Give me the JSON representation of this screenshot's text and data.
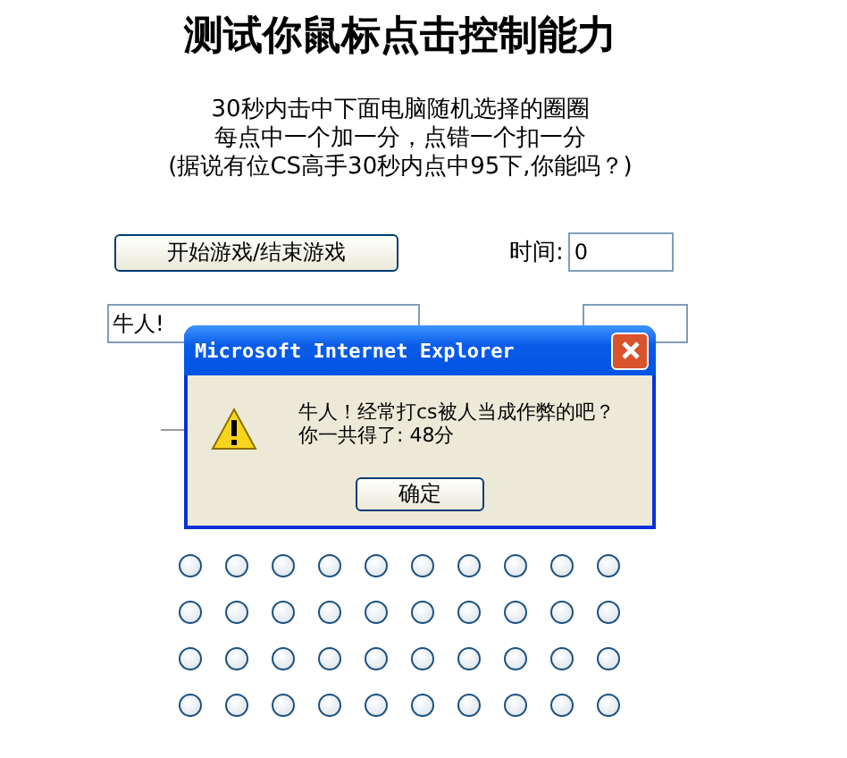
{
  "heading": "测试你鼠标点击控制能力",
  "intro": [
    "30秒内击中下面电脑随机选择的圈圈",
    "每点中一个加一分，点错一个扣一分",
    "(据说有位CS高手30秒内点中95下,你能吗？)"
  ],
  "start_button": "开始游戏/结束游戏",
  "time": {
    "label": "时间:",
    "value": "0"
  },
  "message_field": {
    "value": "牛人!"
  },
  "grid": [
    {
      "circles": [
        {
          "selected": false
        },
        {
          "selected": false
        },
        {
          "selected": false
        },
        {
          "selected": false
        },
        {
          "selected": false
        },
        {
          "selected": false
        },
        {
          "selected": false
        },
        {
          "selected": false
        },
        {
          "selected": false
        },
        {
          "selected": false
        }
      ]
    },
    {
      "circles": [
        {
          "selected": false
        },
        {
          "selected": false
        },
        {
          "selected": false
        },
        {
          "selected": false
        },
        {
          "selected": false
        },
        {
          "selected": false
        },
        {
          "selected": false
        },
        {
          "selected": false
        },
        {
          "selected": false
        },
        {
          "selected": false
        }
      ]
    },
    {
      "circles": [
        {
          "selected": false
        },
        {
          "selected": false
        },
        {
          "selected": false
        },
        {
          "selected": false
        },
        {
          "selected": false
        },
        {
          "selected": false
        },
        {
          "selected": false
        },
        {
          "selected": false
        },
        {
          "selected": false
        },
        {
          "selected": false
        }
      ]
    },
    {
      "circles": [
        {
          "selected": false
        },
        {
          "selected": false
        },
        {
          "selected": false
        },
        {
          "selected": false
        },
        {
          "selected": false
        },
        {
          "selected": false
        },
        {
          "selected": false
        },
        {
          "selected": false
        },
        {
          "selected": false
        },
        {
          "selected": false
        }
      ]
    }
  ],
  "dialog": {
    "title": "Microsoft Internet Explorer",
    "lines": [
      "牛人！经常打cs被人当成作弊的吧？",
      "你一共得了:  48分"
    ],
    "ok_button": "确定"
  }
}
